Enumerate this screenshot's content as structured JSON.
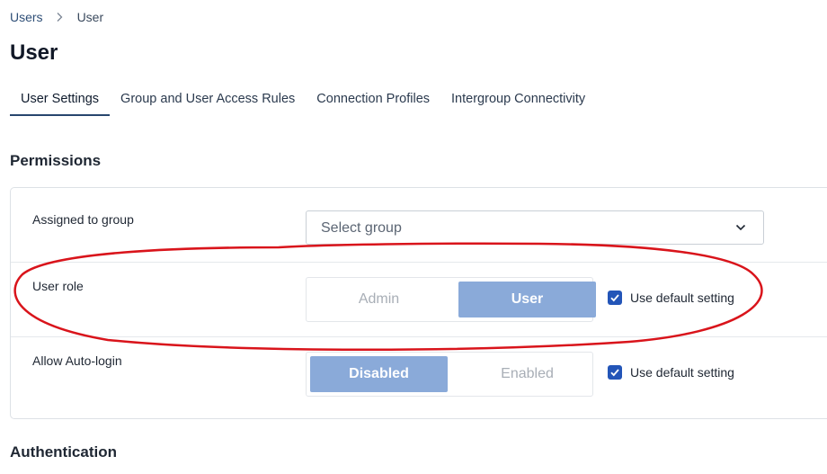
{
  "breadcrumb": {
    "parent": "Users",
    "current": "User"
  },
  "page": {
    "title": "User"
  },
  "tabs": [
    {
      "label": "User Settings",
      "active": true
    },
    {
      "label": "Group and User Access Rules",
      "active": false
    },
    {
      "label": "Connection Profiles",
      "active": false
    },
    {
      "label": "Intergroup Connectivity",
      "active": false
    }
  ],
  "sections": {
    "permissions": "Permissions",
    "authentication": "Authentication"
  },
  "permissions": {
    "group": {
      "label": "Assigned to group",
      "placeholder": "Select group"
    },
    "role": {
      "label": "User role",
      "options": [
        "Admin",
        "User"
      ],
      "selected": "User",
      "default_label": "Use default setting",
      "default_checked": true
    },
    "autologin": {
      "label": "Allow Auto-login",
      "options": [
        "Disabled",
        "Enabled"
      ],
      "selected": "Disabled",
      "default_label": "Use default setting",
      "default_checked": true
    }
  },
  "colors": {
    "accent": "#27466e",
    "selected_segment": "#8aaad9",
    "checkbox": "#2355b8",
    "annotation": "#d9141b"
  },
  "icons": {
    "breadcrumb_separator": "chevron-right-icon",
    "dropdown": "chevron-down-icon",
    "checkbox": "checkmark-icon"
  }
}
